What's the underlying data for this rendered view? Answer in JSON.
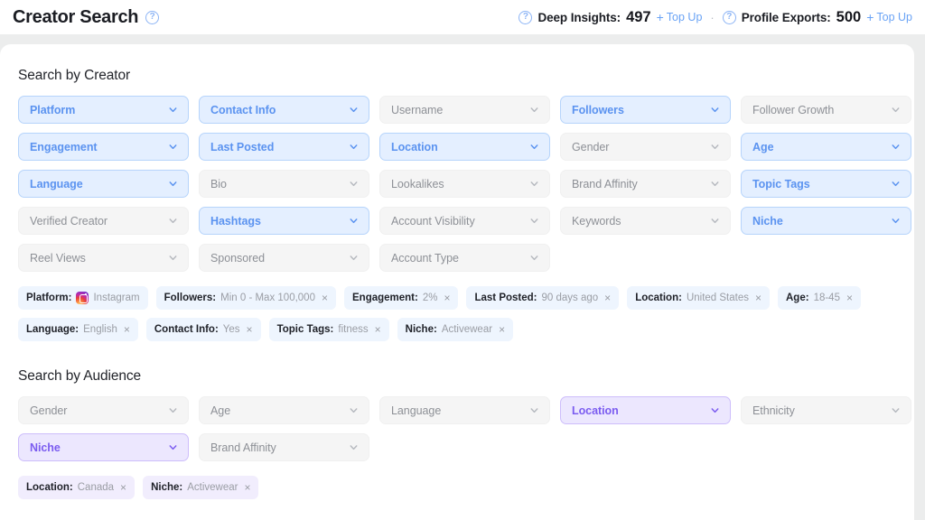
{
  "header": {
    "title": "Creator Search",
    "help_icon": "help-circle-icon",
    "credits": [
      {
        "help_icon": "help-circle-icon",
        "label": "Deep Insights:",
        "value": "497",
        "topup_plus": "+",
        "topup_label": "Top Up"
      },
      {
        "help_icon": "help-circle-icon",
        "label": "Profile Exports:",
        "value": "500",
        "topup_plus": "+",
        "topup_label": "Top Up"
      }
    ],
    "separator": "·"
  },
  "creator_section": {
    "title": "Search by Creator",
    "filters": [
      {
        "label": "Platform",
        "state": "on-blue"
      },
      {
        "label": "Contact Info",
        "state": "on-blue"
      },
      {
        "label": "Username",
        "state": "off"
      },
      {
        "label": "Followers",
        "state": "on-blue"
      },
      {
        "label": "Follower Growth",
        "state": "off"
      },
      {
        "label": "Engagement",
        "state": "on-blue"
      },
      {
        "label": "Last Posted",
        "state": "on-blue"
      },
      {
        "label": "Location",
        "state": "on-blue"
      },
      {
        "label": "Gender",
        "state": "off"
      },
      {
        "label": "Age",
        "state": "on-blue"
      },
      {
        "label": "Language",
        "state": "on-blue"
      },
      {
        "label": "Bio",
        "state": "off"
      },
      {
        "label": "Lookalikes",
        "state": "off"
      },
      {
        "label": "Brand Affinity",
        "state": "off"
      },
      {
        "label": "Topic Tags",
        "state": "on-blue"
      },
      {
        "label": "Verified Creator",
        "state": "off"
      },
      {
        "label": "Hashtags",
        "state": "on-blue"
      },
      {
        "label": "Account Visibility",
        "state": "off"
      },
      {
        "label": "Keywords",
        "state": "off"
      },
      {
        "label": "Niche",
        "state": "on-blue"
      },
      {
        "label": "Reel Views",
        "state": "off"
      },
      {
        "label": "Sponsored",
        "state": "off"
      },
      {
        "label": "Account Type",
        "state": "off"
      }
    ],
    "chips": [
      {
        "key": "Platform:",
        "value": "Instagram",
        "icon": "instagram-icon",
        "removable": false
      },
      {
        "key": "Followers:",
        "value": "Min 0 - Max 100,000",
        "removable": true
      },
      {
        "key": "Engagement:",
        "value": "2%",
        "removable": true
      },
      {
        "key": "Last Posted:",
        "value": "90 days ago",
        "removable": true
      },
      {
        "key": "Location:",
        "value": "United States",
        "removable": true
      },
      {
        "key": "Age:",
        "value": "18-45",
        "removable": true
      },
      {
        "key": "Language:",
        "value": "English",
        "removable": true
      },
      {
        "key": "Contact Info:",
        "value": "Yes",
        "removable": true
      },
      {
        "key": "Topic Tags:",
        "value": "fitness",
        "removable": true
      },
      {
        "key": "Niche:",
        "value": "Activewear",
        "removable": true
      }
    ]
  },
  "audience_section": {
    "title": "Search by Audience",
    "filters": [
      {
        "label": "Gender",
        "state": "off"
      },
      {
        "label": "Age",
        "state": "off"
      },
      {
        "label": "Language",
        "state": "off"
      },
      {
        "label": "Location",
        "state": "on-purple"
      },
      {
        "label": "Ethnicity",
        "state": "off"
      },
      {
        "label": "Niche",
        "state": "on-purple"
      },
      {
        "label": "Brand Affinity",
        "state": "off"
      }
    ],
    "chips": [
      {
        "key": "Location:",
        "value": "Canada",
        "removable": true
      },
      {
        "key": "Niche:",
        "value": "Activewear",
        "removable": true
      }
    ]
  },
  "icons": {
    "chevron_down": "chevron-down-icon",
    "remove": "×"
  },
  "colors": {
    "creator_accent": "#5b93f0",
    "audience_accent": "#7b5cf0",
    "page_background": "#eceded",
    "card_background": "#ffffff"
  }
}
